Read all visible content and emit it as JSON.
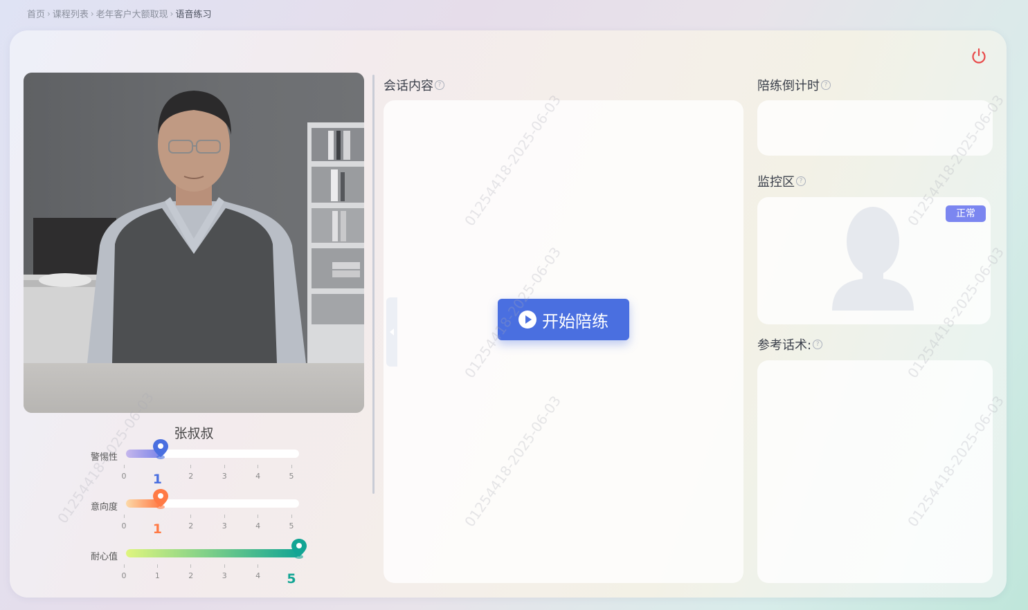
{
  "breadcrumb": [
    "首页",
    "课程列表",
    "老年客户大额取现",
    "语音练习"
  ],
  "character": {
    "name": "张叔叔"
  },
  "meters": [
    {
      "label": "警惕性",
      "value": 1,
      "max": 5,
      "color": "#4a6fe0",
      "fill_from": "#c5b6ec",
      "fill_to": "#7d86e8"
    },
    {
      "label": "意向度",
      "value": 1,
      "max": 5,
      "color": "#ff7a45",
      "fill_from": "#fcd9a8",
      "fill_to": "#ff7a45"
    },
    {
      "label": "耐心值",
      "value": 5,
      "max": 5,
      "color": "#12a594",
      "fill_from": "#dff57e",
      "fill_to": "#12a594"
    }
  ],
  "ticks": [
    "0",
    "1",
    "2",
    "3",
    "4",
    "5"
  ],
  "sections": {
    "conversation": "会话内容",
    "countdown": "陪练倒计时",
    "monitor": "监控区",
    "reference": "参考话术:"
  },
  "help_glyph": "?",
  "start_button": "开始陪练",
  "monitor_status": "正常",
  "watermark": "01254418-2025-06-03",
  "colors": {
    "primary": "#4a6fe0",
    "badge": "#7b86f0",
    "power": "#e84a4a"
  }
}
